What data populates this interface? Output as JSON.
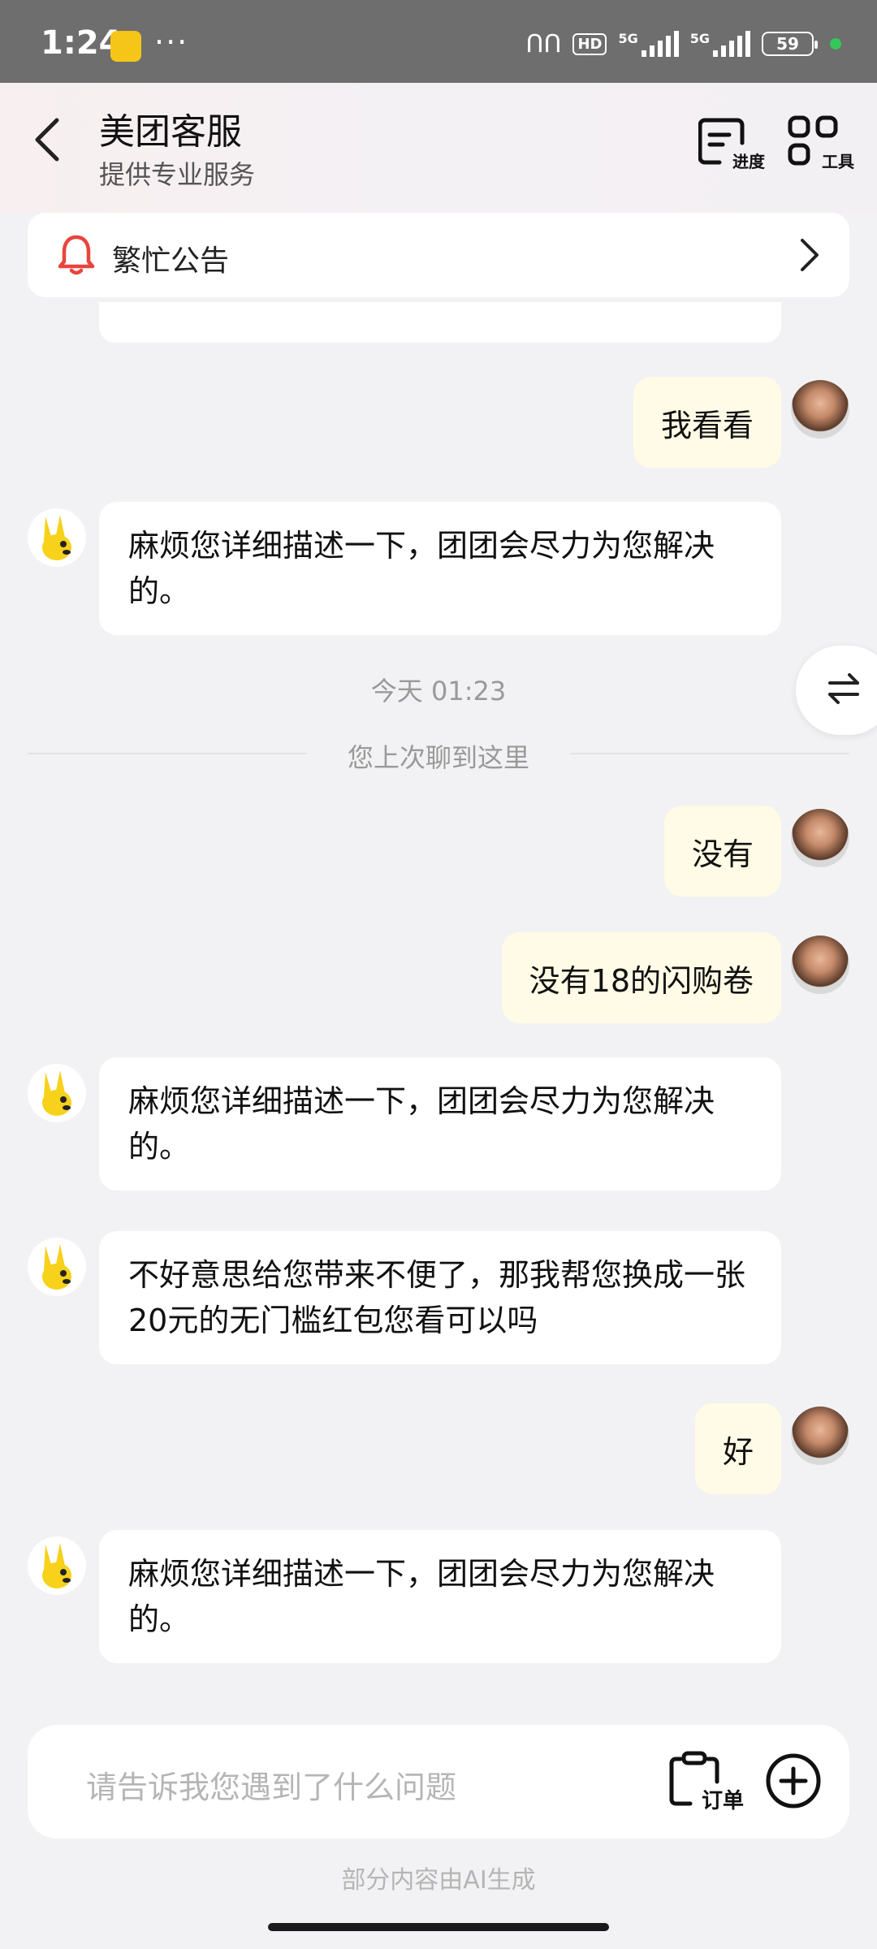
{
  "status_bar": {
    "time": "1:24",
    "more": "···",
    "hd_label": "HD",
    "net1": "5G",
    "net2": "5G",
    "battery": "59"
  },
  "header": {
    "title": "美团客服",
    "subtitle": "提供专业服务",
    "progress_label": "进度",
    "tools_label": "工具"
  },
  "notice": {
    "text": "繁忙公告"
  },
  "messages": [
    {
      "from": "user",
      "text": "我看看"
    },
    {
      "from": "bot",
      "text": "麻烦您详细描述一下，团团会尽力为您解决的。"
    },
    {
      "from": "user",
      "text": "没有"
    },
    {
      "from": "user",
      "text": "没有18的闪购卷"
    },
    {
      "from": "bot",
      "text": "麻烦您详细描述一下，团团会尽力为您解决的。"
    },
    {
      "from": "bot",
      "text": "不好意思给您带来不便了，那我帮您换成一张20元的无门槛红包您看可以吗"
    },
    {
      "from": "user",
      "text": "好"
    },
    {
      "from": "bot",
      "text": "麻烦您详细描述一下，团团会尽力为您解决的。"
    }
  ],
  "timestamp": "今天 01:23",
  "last_read": "您上次聊到这里",
  "input": {
    "placeholder": "请告诉我您遇到了什么问题",
    "order_label": "订单"
  },
  "footer_note": "部分内容由AI生成",
  "colors": {
    "user_bubble": "#fffbe6",
    "bot_bubble": "#ffffff",
    "bell_red": "#e8453c",
    "mascot_yellow": "#f7d11a"
  }
}
